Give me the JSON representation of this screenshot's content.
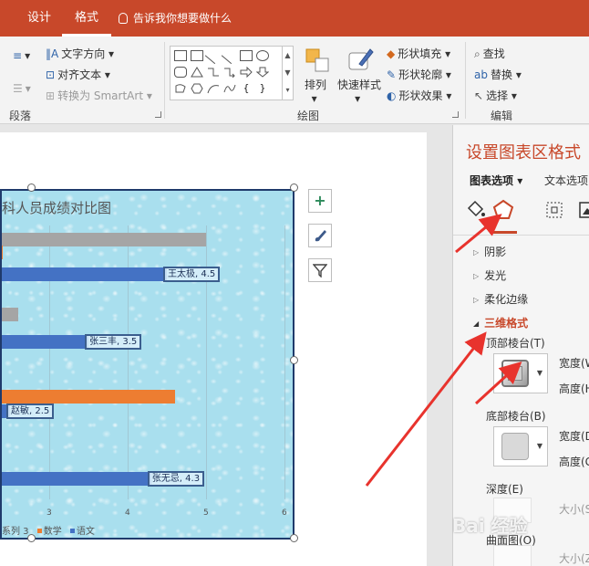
{
  "tabs": [
    {
      "label": "设计"
    },
    {
      "label": "格式"
    }
  ],
  "tell_me": "告诉我你想要做什么",
  "ribbon": {
    "text_direction": "文字方向",
    "align_text": "对齐文本",
    "convert_smartart": "转换为 SmartArt",
    "paragraph_label": "段落",
    "arrange": "排列",
    "quick_styles": "快速样式",
    "shape_fill": "形状填充",
    "shape_outline": "形状轮廓",
    "shape_effects": "形状效果",
    "drawing_label": "绘图",
    "find": "查找",
    "replace": "替换",
    "select": "选择",
    "editing_label": "编辑"
  },
  "chart": {
    "title": "科人员成绩对比图",
    "legend": [
      "系列 3",
      "数学",
      "语文"
    ],
    "colors": {
      "series3": "#a5a5a5",
      "math": "#ed7d31",
      "chinese": "#4472c4",
      "border": "#1f3a6b",
      "background": "#a9dfee"
    }
  },
  "chart_data": {
    "type": "bar",
    "orientation": "horizontal",
    "title": "科人员成绩对比图",
    "xlim": [
      0,
      6
    ],
    "x_ticks": [
      "3",
      "4",
      "5",
      "6"
    ],
    "series": [
      {
        "name": "系列 3",
        "values": [
          5.0,
          2.6
        ]
      },
      {
        "name": "数学",
        "values": [
          2.4,
          4.6
        ]
      },
      {
        "name": "语文",
        "values": [
          4.5,
          3.5,
          2.5,
          4.3
        ]
      }
    ],
    "data_labels": [
      "王太极, 4.5",
      "张三丰, 3.5",
      "赵敏, 2.5",
      "张无忌, 4.3"
    ],
    "grid": true,
    "legend_position": "bottom"
  },
  "panel": {
    "title": "设置图表区格式",
    "tab_chart_options": "图表选项",
    "tab_text_options": "文本选项",
    "sections": {
      "shadow": "阴影",
      "glow": "发光",
      "soft_edges": "柔化边缘",
      "three_d_format": "三维格式"
    },
    "top_bevel": "顶部棱台(T)",
    "bottom_bevel": "底部棱台(B)",
    "width_top": "宽度(W",
    "height_top": "高度(H",
    "width_bottom": "宽度(D",
    "height_bottom": "高度(G",
    "depth": "深度(E)",
    "size_1": "大小(S",
    "contour": "曲面图(O)",
    "size_2": "大小(Z"
  },
  "watermark": "Bai 经验"
}
